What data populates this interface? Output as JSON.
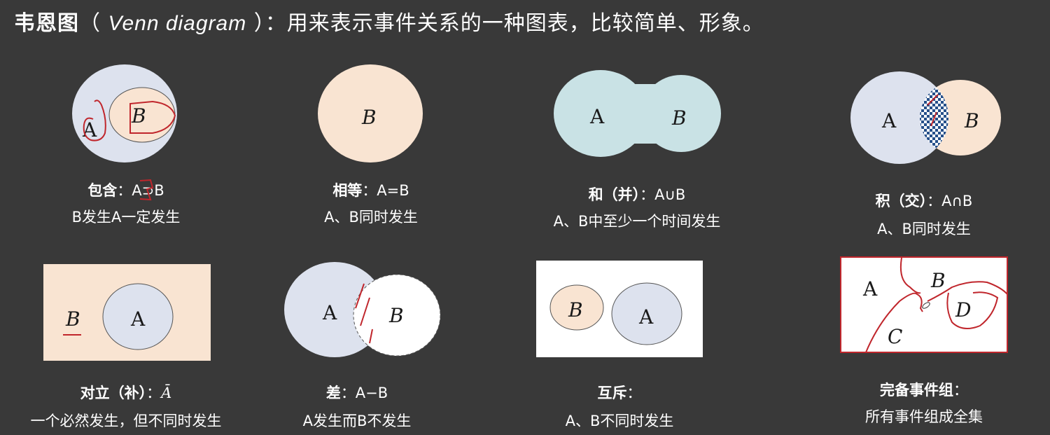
{
  "title": {
    "term": "韦恩图",
    "open": "（ ",
    "en": "Venn diagram",
    "close": " ）",
    "rest": "：用来表示事件关系的一种图表，比较简单、形象。"
  },
  "colors": {
    "background": "#393939",
    "circle_blue": "#dde2ee",
    "circle_peach": "#f9e4d2",
    "circle_teal": "#c9e2e5",
    "annotation_red": "#c0262c",
    "checker": "#26508a"
  },
  "panels": [
    {
      "id": "inclusion",
      "labels": [
        "A",
        "B"
      ],
      "name": "包含",
      "formula": "：A⊃B",
      "desc": "B发生A一定发生"
    },
    {
      "id": "equality",
      "labels": [
        "B"
      ],
      "name": "相等",
      "formula": "：A=B",
      "desc": "A、B同时发生"
    },
    {
      "id": "union",
      "labels": [
        "A",
        "B"
      ],
      "name": "和（并）",
      "formula": "：A∪B",
      "desc": "A、B中至少一个时间发生"
    },
    {
      "id": "intersection",
      "labels": [
        "A",
        "B"
      ],
      "name": "积（交）",
      "formula": "：A∩B",
      "desc": "A、B同时发生"
    },
    {
      "id": "complement",
      "labels": [
        "B",
        "A"
      ],
      "name": "对立（补）",
      "formula": "：",
      "formula_sym": "Ā",
      "desc": "一个必然发生，但不同时发生"
    },
    {
      "id": "difference",
      "labels": [
        "A",
        "B"
      ],
      "name": "差",
      "formula": "：A−B",
      "desc": "A发生而B不发生"
    },
    {
      "id": "mutual_exclusion",
      "labels": [
        "B",
        "A"
      ],
      "name": "互斥",
      "formula": "：",
      "desc": "A、B不同时发生"
    },
    {
      "id": "complete_group",
      "labels": [
        "A",
        "B",
        "C",
        "D"
      ],
      "name": "完备事件组",
      "formula": "：",
      "desc": "所有事件组成全集"
    }
  ]
}
